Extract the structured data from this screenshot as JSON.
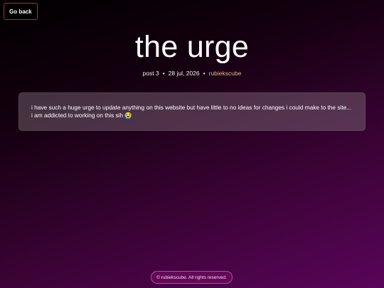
{
  "nav": {
    "back_label": "Go back"
  },
  "post": {
    "title": "the urge",
    "number": "post 3",
    "separator": "•",
    "date": "28 jul, 2026",
    "author": "rubiekscube",
    "body": "i have such a huge urge to update anything on this website but have little to no ideas for changes i could make to the site... i am addicted to working on this sih 😭"
  },
  "footer": {
    "text": "© rubiekscube. All rights reserved."
  },
  "colors": {
    "accent_author": "#f0b48a",
    "back_border": "#b8263e",
    "footer_border": "#b54a97"
  }
}
